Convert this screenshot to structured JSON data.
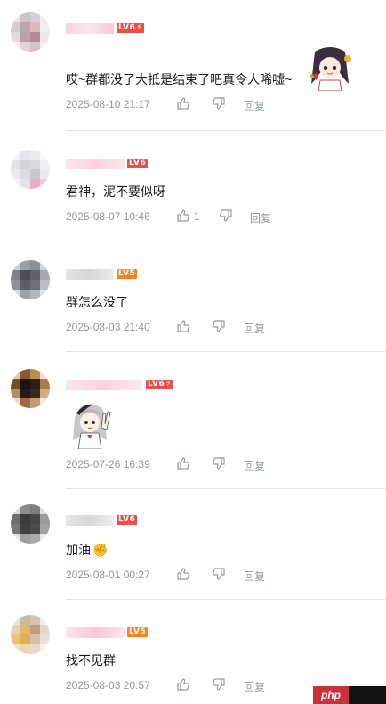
{
  "comments": [
    {
      "level": "LV6",
      "level_bolt": "⚡",
      "text": "哎~群都没了大抵是结束了吧真令人唏嘘~",
      "time": "2025-08-10 21:17",
      "like_count": "",
      "reply": "回复",
      "sticker": "anime-girl-sticker"
    },
    {
      "level": "LV6",
      "level_bolt": "",
      "text": "君神，泥不要似呀",
      "time": "2025-08-07 10:46",
      "like_count": "1",
      "reply": "回复"
    },
    {
      "level": "LV5",
      "level_bolt": "",
      "text": "群怎么没了",
      "time": "2025-08-03 21:40",
      "like_count": "",
      "reply": "回复"
    },
    {
      "level": "LV6",
      "level_bolt": "⚡",
      "text": "",
      "time": "2025-07-26 16:39",
      "like_count": "",
      "reply": "回复",
      "sticker": "anime-girl-peace-sticker"
    },
    {
      "level": "LV6",
      "level_bolt": "",
      "text": "加油",
      "emoji": "✊",
      "time": "2025-08-01 00:27",
      "like_count": "",
      "reply": "回复"
    },
    {
      "level": "LV5",
      "level_bolt": "",
      "text": "找不见群",
      "time": "2025-08-03 20:57",
      "like_count": "",
      "reply": "回复"
    }
  ],
  "watermark": {
    "text": "php"
  },
  "colors": {
    "text": "#18191c",
    "meta": "#9499a0",
    "divider": "#e3e5e7",
    "lv6": "#f04c49",
    "lv5": "#ff7f24",
    "username_blur": "#f9c8d6"
  },
  "icons": [
    "like-icon",
    "dislike-icon"
  ]
}
